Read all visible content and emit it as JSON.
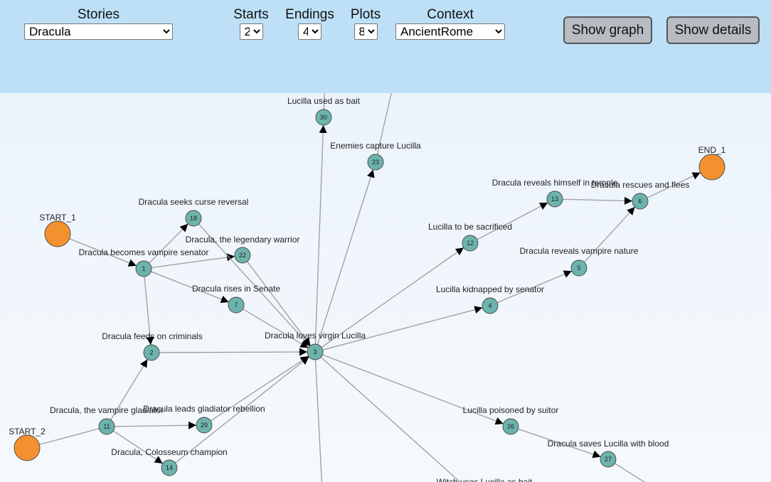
{
  "controls": {
    "stories": {
      "label": "Stories",
      "value": "Dracula"
    },
    "starts": {
      "label": "Starts",
      "value": "2"
    },
    "endings": {
      "label": "Endings",
      "value": "4"
    },
    "plots": {
      "label": "Plots",
      "value": "8"
    },
    "context": {
      "label": "Context",
      "value": "AncientRome"
    },
    "show_graph": "Show graph",
    "show_details": "Show details"
  },
  "colors": {
    "terminal": "#f3912f",
    "plot": "#6db3ad",
    "edge": "#9c9c9c",
    "toolbar": "#bde0f6"
  },
  "nodes": [
    {
      "id": "START_1",
      "kind": "terminal",
      "label": "START_1",
      "num": ""
    },
    {
      "id": "START_2",
      "kind": "terminal",
      "label": "START_2",
      "num": ""
    },
    {
      "id": "END_1",
      "kind": "terminal",
      "label": "END_1",
      "num": ""
    },
    {
      "id": "n1",
      "kind": "plot",
      "label": "Dracula becomes vampire senator",
      "num": "1"
    },
    {
      "id": "n2",
      "kind": "plot",
      "label": "Dracula feeds on criminals",
      "num": "2"
    },
    {
      "id": "n3",
      "kind": "plot",
      "label": "Dracula loves virgin Lucilla",
      "num": "3"
    },
    {
      "id": "n4",
      "kind": "plot",
      "label": "Lucilla kidnapped by senator",
      "num": "4"
    },
    {
      "id": "n5",
      "kind": "plot",
      "label": "Dracula reveals vampire nature",
      "num": "5"
    },
    {
      "id": "n6",
      "kind": "plot",
      "label": "Dracula rescues and flees",
      "num": "6"
    },
    {
      "id": "n7",
      "kind": "plot",
      "label": "Dracula rises in Senate",
      "num": "7"
    },
    {
      "id": "n11",
      "kind": "plot",
      "label": "Dracula, the vampire gladiator",
      "num": "11"
    },
    {
      "id": "n12",
      "kind": "plot",
      "label": "Lucilla to be sacrificed",
      "num": "12"
    },
    {
      "id": "n13",
      "kind": "plot",
      "label": "Dracula reveals himself in temple",
      "num": "13"
    },
    {
      "id": "n14",
      "kind": "plot",
      "label": "Dracula, Colosseum champion",
      "num": "14"
    },
    {
      "id": "n18",
      "kind": "plot",
      "label": "Dracula seeks curse reversal",
      "num": "18"
    },
    {
      "id": "n22",
      "kind": "plot",
      "label": "Dracula, the legendary warrior",
      "num": "22"
    },
    {
      "id": "n23",
      "kind": "plot",
      "label": "Enemies capture Lucilla",
      "num": "23"
    },
    {
      "id": "n26",
      "kind": "plot",
      "label": "Lucilla poisoned by suitor",
      "num": "26"
    },
    {
      "id": "n27",
      "kind": "plot",
      "label": "Dracula saves Lucilla with blood",
      "num": "27"
    },
    {
      "id": "n29",
      "kind": "plot",
      "label": "Dracula leads gladiator rebellion",
      "num": "29"
    },
    {
      "id": "n30",
      "kind": "plot",
      "label": "Lucilla used as bait",
      "num": "30"
    },
    {
      "id": "cut",
      "kind": "label",
      "label": "Witch uses Lucilla as bait",
      "num": ""
    }
  ],
  "edges": [
    {
      "from": "START_1",
      "to": "n1",
      "arrow": true
    },
    {
      "from": "START_2",
      "to": "n11",
      "arrow": false
    },
    {
      "from": "n1",
      "to": "n18",
      "arrow": true
    },
    {
      "from": "n1",
      "to": "n22",
      "arrow": true
    },
    {
      "from": "n1",
      "to": "n7",
      "arrow": true
    },
    {
      "from": "n1",
      "to": "n2",
      "arrow": true
    },
    {
      "from": "n18",
      "to": "n3",
      "arrow": true
    },
    {
      "from": "n22",
      "to": "n3",
      "arrow": true
    },
    {
      "from": "n7",
      "to": "n3",
      "arrow": true
    },
    {
      "from": "n2",
      "to": "n3",
      "arrow": true
    },
    {
      "from": "n11",
      "to": "n2",
      "arrow": true
    },
    {
      "from": "n11",
      "to": "n29",
      "arrow": true
    },
    {
      "from": "n11",
      "to": "n14",
      "arrow": true
    },
    {
      "from": "n29",
      "to": "n3",
      "arrow": true
    },
    {
      "from": "n14",
      "to": "n3",
      "arrow": true
    },
    {
      "from": "n3",
      "to": "n30",
      "arrow": true
    },
    {
      "from": "n3",
      "to": "n23",
      "arrow": true
    },
    {
      "from": "n3",
      "to": "n12",
      "arrow": true
    },
    {
      "from": "n3",
      "to": "n4",
      "arrow": true
    },
    {
      "from": "n3",
      "to": "n26",
      "arrow": true
    },
    {
      "from": "n3",
      "to": "offBottom",
      "arrow": false
    },
    {
      "from": "n3",
      "to": "offBottomRight",
      "arrow": false
    },
    {
      "from": "n30",
      "to": "offTop30",
      "arrow": false
    },
    {
      "from": "n23",
      "to": "offTop23",
      "arrow": false
    },
    {
      "from": "n12",
      "to": "n13",
      "arrow": true
    },
    {
      "from": "n13",
      "to": "n6",
      "arrow": true
    },
    {
      "from": "n4",
      "to": "n5",
      "arrow": true
    },
    {
      "from": "n5",
      "to": "n6",
      "arrow": true
    },
    {
      "from": "n6",
      "to": "END_1",
      "arrow": true
    },
    {
      "from": "n26",
      "to": "n27",
      "arrow": true
    },
    {
      "from": "n27",
      "to": "offBottom27",
      "arrow": false
    }
  ]
}
